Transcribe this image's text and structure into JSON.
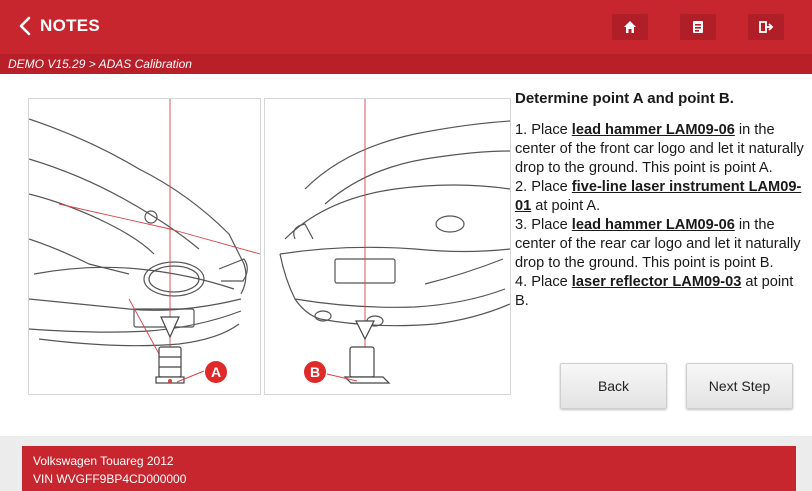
{
  "header": {
    "title": "NOTES"
  },
  "breadcrumb": "DEMO V15.29 > ADAS Calibration",
  "content": {
    "heading": "Determine point A and point B.",
    "steps": [
      {
        "a": "1. Place ",
        "b": "lead hammer LAM09-06",
        "c": " in the center of the front car logo and let it naturally drop to the ground. This point is point A."
      },
      {
        "a": "2. Place ",
        "b": "five-line laser instrument LAM09-01",
        "c": " at point A."
      },
      {
        "a": "3. Place ",
        "b": "lead hammer LAM09-06",
        "c": " in the center of the rear car logo and let it naturally drop to the ground. This point is point B."
      },
      {
        "a": "4. Place ",
        "b": "laser reflector LAM09-03",
        "c": " at point B."
      }
    ]
  },
  "diagram": {
    "marker_a": "A",
    "marker_b": "B"
  },
  "buttons": {
    "back": "Back",
    "next": "Next Step"
  },
  "footer": {
    "vehicle": "Volkswagen Touareg 2012",
    "vin": "VIN WVGFF9BP4CD000000"
  },
  "colors": {
    "brand_red": "#c8262f",
    "dark_red": "#b01e27"
  },
  "icons": {
    "back": "chevron-left-icon",
    "home": "home-icon",
    "report": "report-icon",
    "exit": "exit-icon"
  }
}
